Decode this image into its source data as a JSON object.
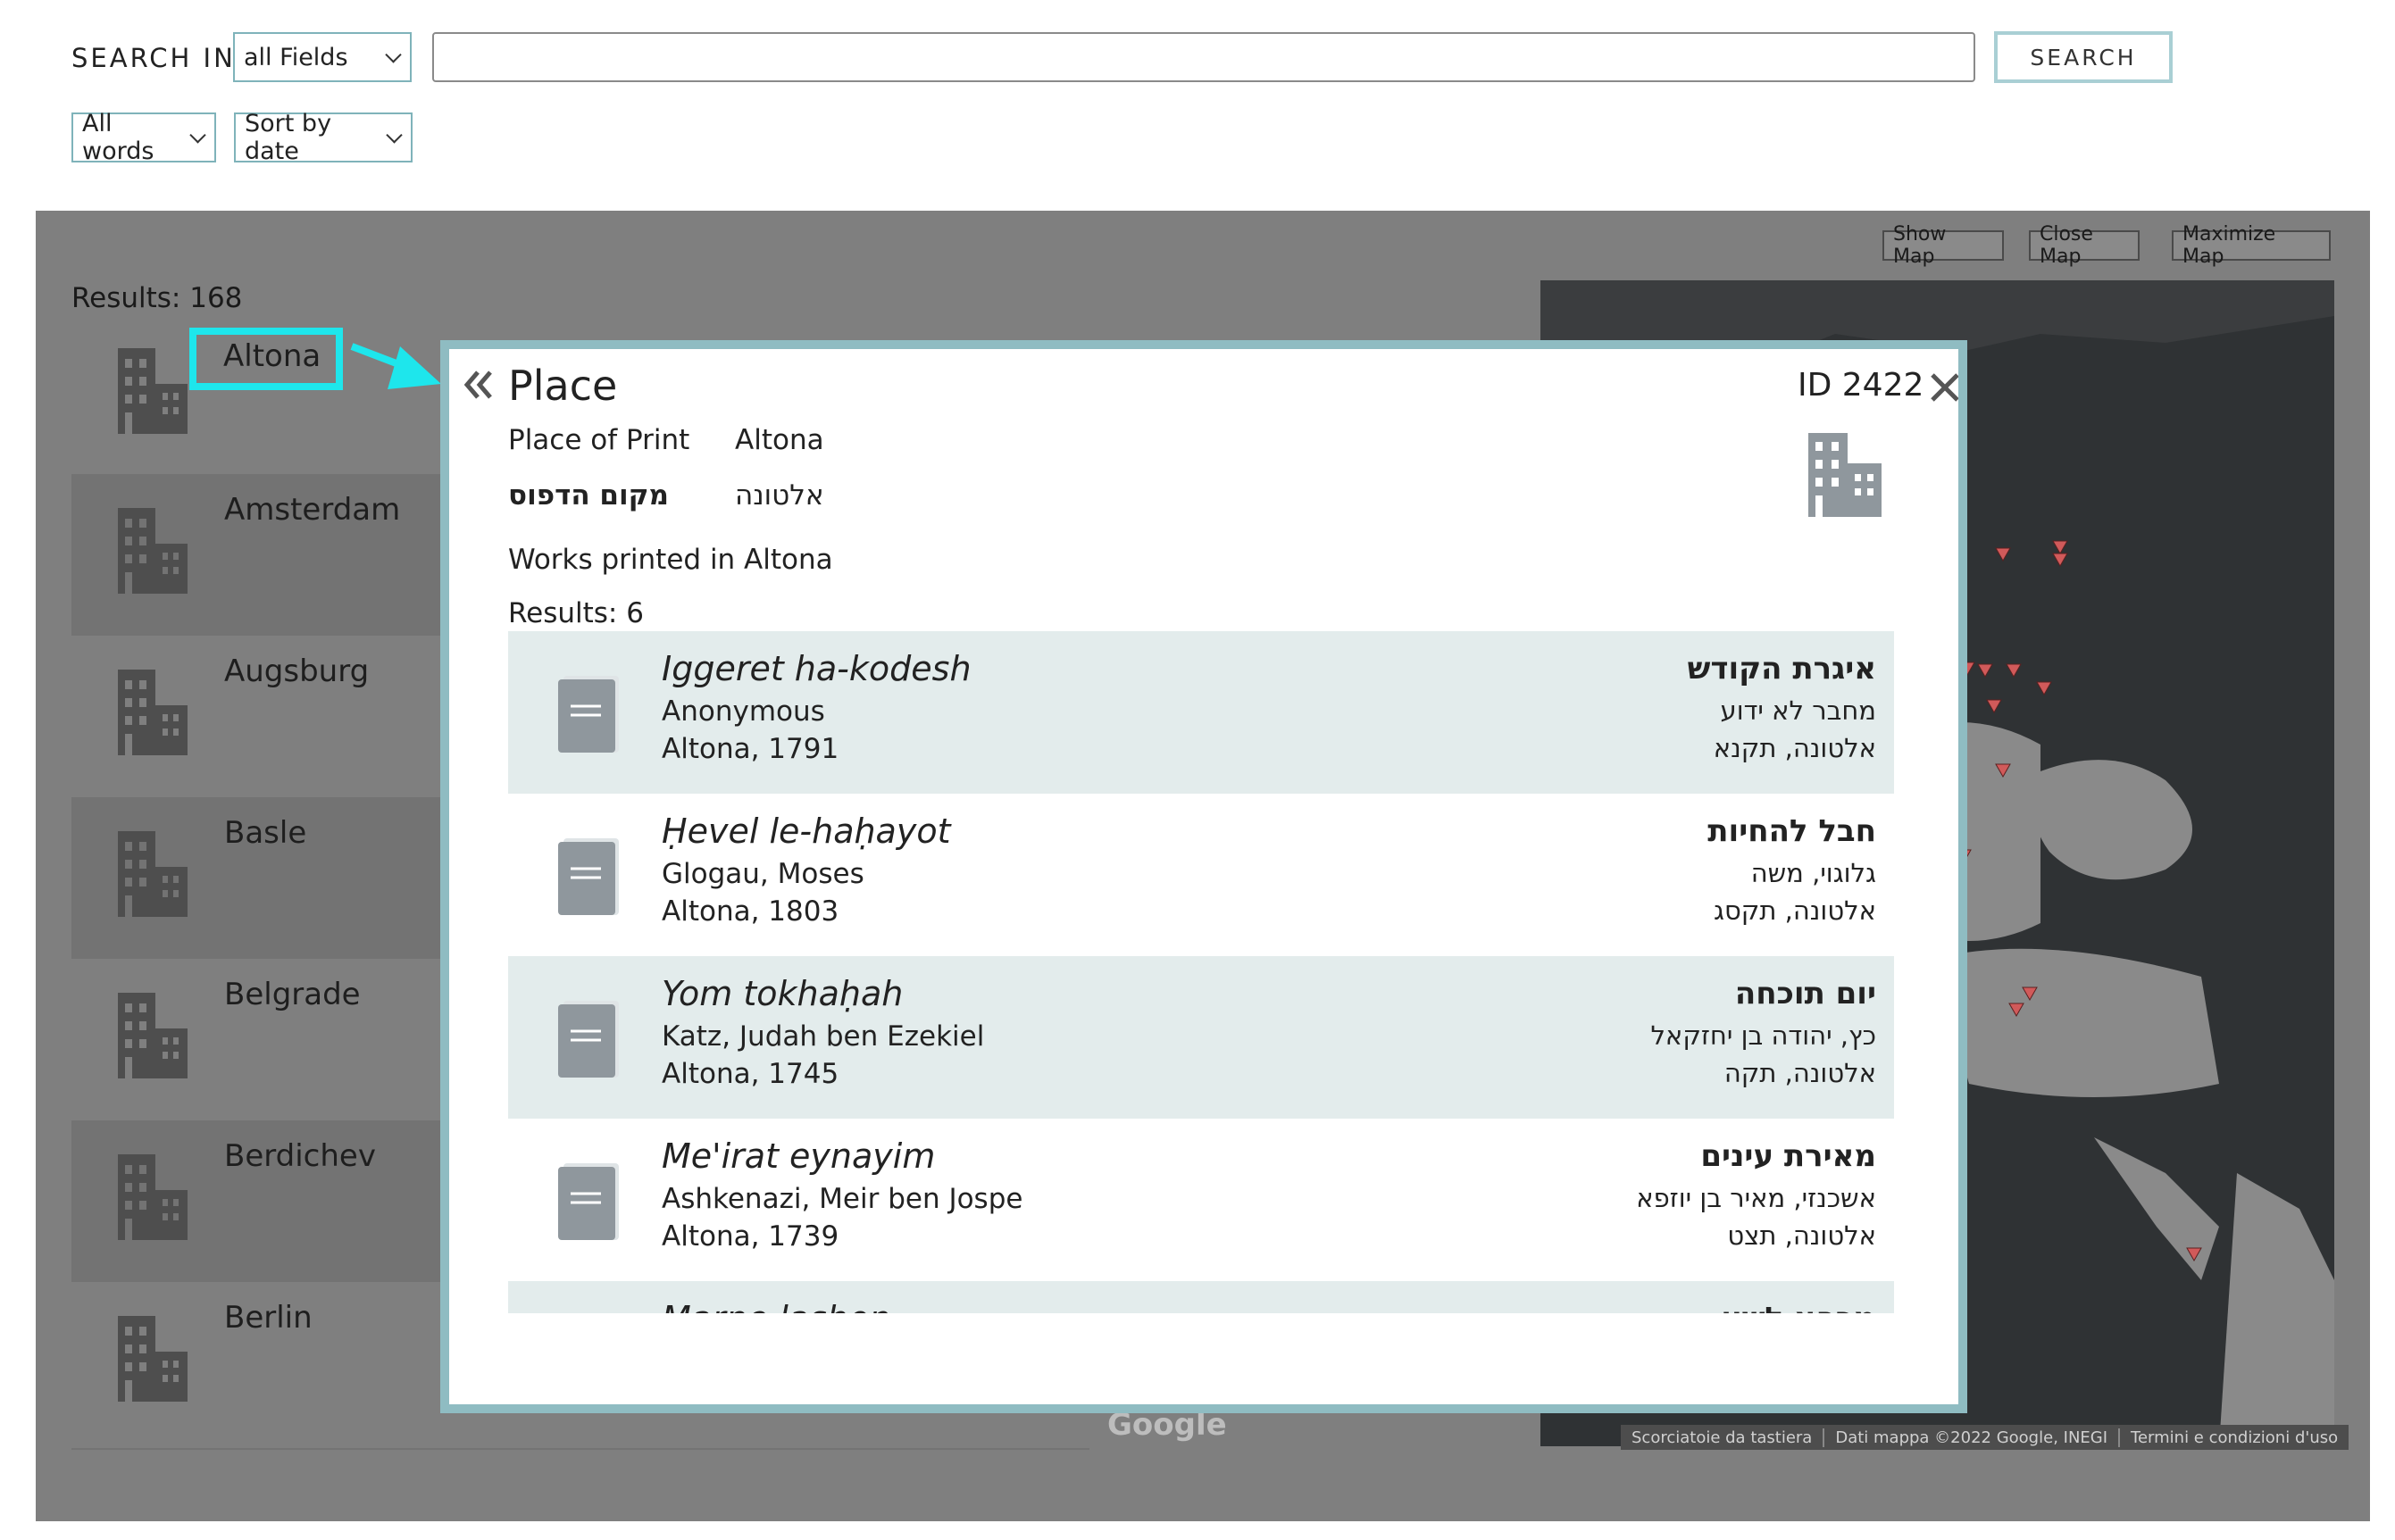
{
  "search": {
    "label": "SEARCH IN",
    "field_select": "all Fields",
    "query": "",
    "button": "SEARCH",
    "words_select": "All words",
    "sort_select": "Sort by date"
  },
  "results": {
    "count_label": "Results: 168",
    "items": [
      {
        "name": "Altona"
      },
      {
        "name": "Amsterdam"
      },
      {
        "name": "Augsburg"
      },
      {
        "name": "Basle"
      },
      {
        "name": "Belgrade"
      },
      {
        "name": "Berdichev"
      },
      {
        "name": "Berlin"
      }
    ]
  },
  "map": {
    "show": "Show Map",
    "close": "Close Map",
    "maximize": "Maximize Map",
    "logo": "Google",
    "footer": [
      "Scorciatoie da tastiera",
      "Dati mappa ©2022 Google, INEGI",
      "Termini e condizioni d'uso"
    ]
  },
  "modal": {
    "title": "Place",
    "id": "ID 2422",
    "place_label": "Place of Print",
    "place_value": "Altona",
    "heb_label": "מקום הדפוס",
    "heb_value": "אלטונה",
    "works_heading": "Works printed in Altona",
    "results": "Results: 6",
    "works": [
      {
        "title": "Iggeret ha-kodesh",
        "author": "Anonymous",
        "imprint": "Altona, 1791",
        "heb_title": "איגרת הקודש",
        "heb_author": "מחבר לא ידוע",
        "heb_imprint": "אלטונה, תקנא"
      },
      {
        "title": "Ḥevel le-haḥayot",
        "author": "Glogau, Moses",
        "imprint": "Altona, 1803",
        "heb_title": "חבל להחיות",
        "heb_author": "גלוגוי, משה",
        "heb_imprint": "אלטונה, תקסג"
      },
      {
        "title": "Yom tokhaḥah",
        "author": "Katz, Judah ben Ezekiel",
        "imprint": "Altona, 1745",
        "heb_title": "יום תוכחה",
        "heb_author": "כץ, יהודה בן יחזקאל",
        "heb_imprint": "אלטונה, תקה"
      },
      {
        "title": "Me'irat eynayim",
        "author": "Ashkenazi, Meir ben Jospe",
        "imprint": "Altona, 1739",
        "heb_title": "מאירת עינים",
        "heb_author": "אשכנזי, מאיר בן יוזפא",
        "heb_imprint": "אלטונה, תצט"
      },
      {
        "title": "Marpe lashon",
        "author": "",
        "imprint": "",
        "heb_title": "מרפא לשון",
        "heb_author": "",
        "heb_imprint": ""
      }
    ]
  },
  "colors": {
    "accent_border": "#8fbcc2",
    "highlight": "#1ee6ec",
    "overlay": "#7f7f7f",
    "row_shade": "#e3ecec",
    "map_marker": "#d15a5a"
  }
}
